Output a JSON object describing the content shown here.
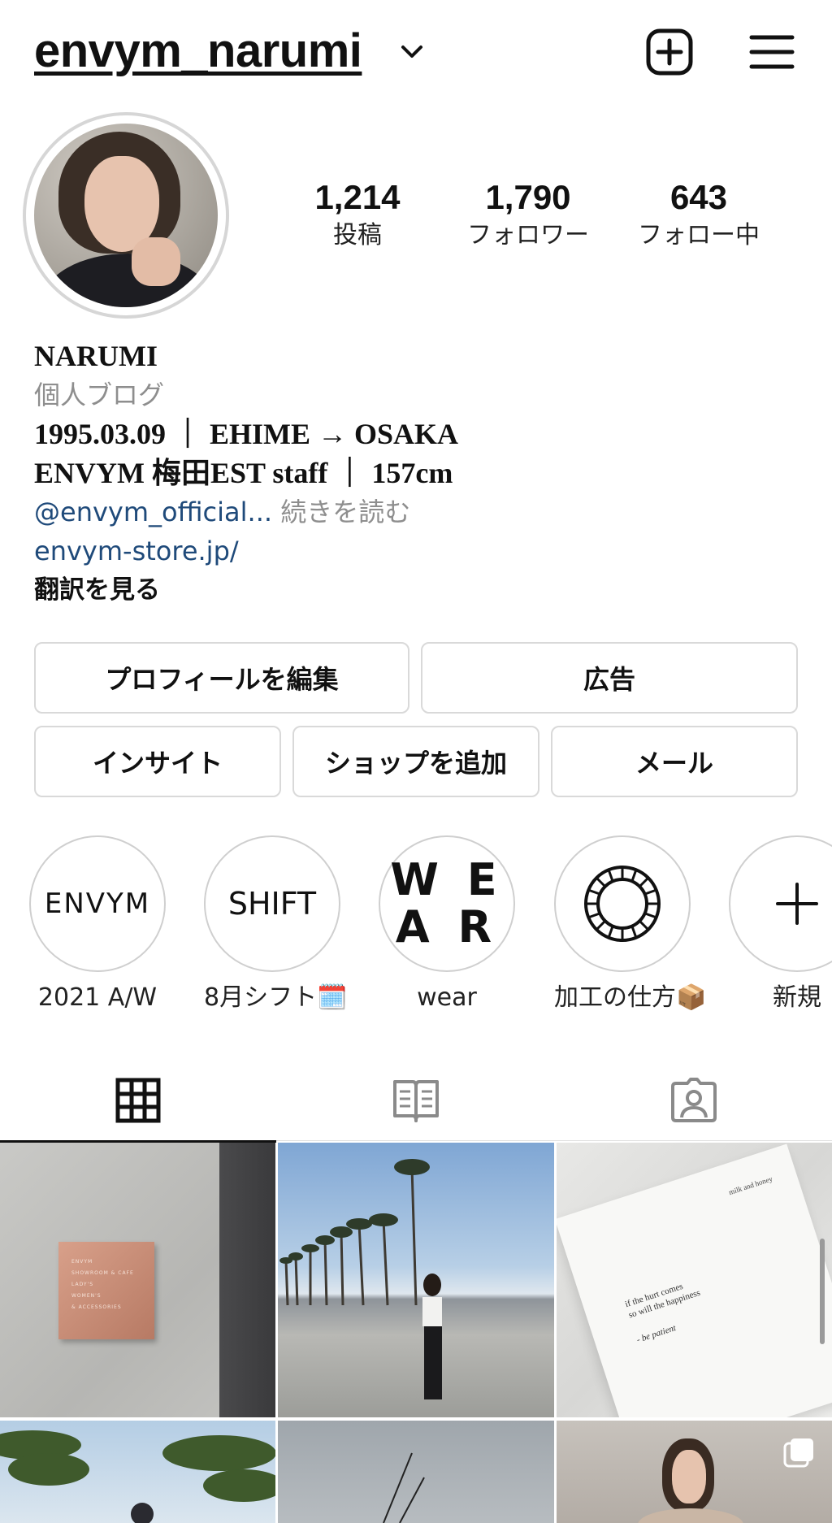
{
  "header": {
    "username": "envym_narumi",
    "icons": [
      "chevron-down-icon",
      "new-post-icon",
      "menu-icon"
    ]
  },
  "stats": [
    {
      "value": "1,214",
      "label": "投稿"
    },
    {
      "value": "1,790",
      "label": "フォロワー"
    },
    {
      "value": "643",
      "label": "フォロー中"
    }
  ],
  "bio": {
    "name": "NARUMI",
    "category": "個人ブログ",
    "line1": "1995.03.09 ｜ EHIME → OSAKA",
    "line2": "ENVYM 梅田EST staff ｜ 157cm",
    "mention": "@envym_official...",
    "more": "続きを読む",
    "website": "envym-store.jp/",
    "translate": "翻訳を見る"
  },
  "buttons": {
    "edit_profile": "プロフィールを編集",
    "ads": "広告",
    "insights": "インサイト",
    "add_shop": "ショップを追加",
    "email": "メール"
  },
  "highlights": [
    {
      "cover_text": "ENVYM",
      "label": "2021 A/W"
    },
    {
      "cover_text": "SHIFT",
      "label": "8月シフト🗓️"
    },
    {
      "cover_text_top": "W E",
      "cover_text_bottom": "A R",
      "label": "wear"
    },
    {
      "cover_icon": "vsco-icon",
      "label": "加工の仕方📦"
    },
    {
      "cover_icon": "plus-icon",
      "label": "新規"
    }
  ],
  "tabs": [
    {
      "icon": "grid-icon",
      "active": true
    },
    {
      "icon": "guide-book-icon",
      "active": false
    },
    {
      "icon": "tagged-person-icon",
      "active": false
    }
  ],
  "posts": {
    "post1_sign_lines": [
      "ENVYM",
      "SHOWROOM & CAFE",
      "LADY'S",
      "WOMEN'S",
      "& ACCESSORIES"
    ],
    "post3_book_header": "milk and honey",
    "post3_poem_line1": "if the hurt comes",
    "post3_poem_line2": "so will the happiness",
    "post3_poem_sig": "- be patient"
  },
  "colors": {
    "link": "#1f4a7a",
    "muted": "#8e8e8e",
    "border": "#d9d9d9"
  }
}
